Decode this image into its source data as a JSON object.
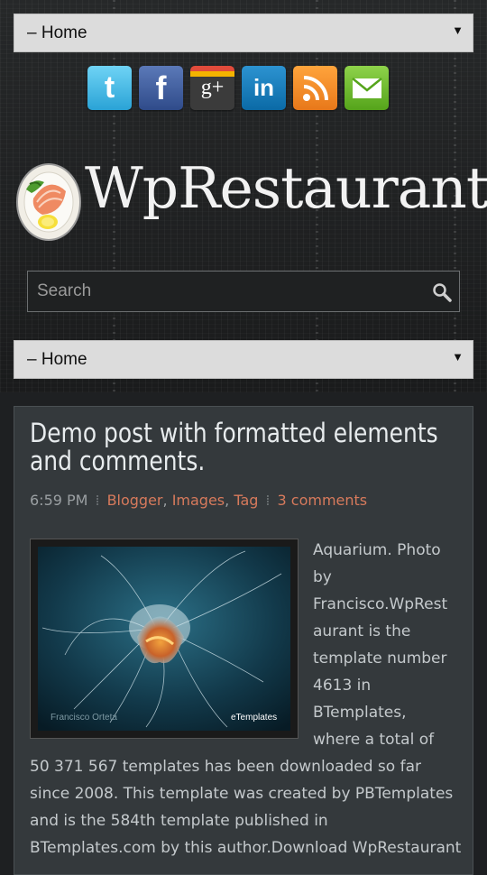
{
  "nav": {
    "top_select": "– Home",
    "bottom_select": "– Home"
  },
  "social": [
    {
      "icon": "twitter-icon",
      "glyph": "t",
      "color": "#3fbbe8"
    },
    {
      "icon": "facebook-icon",
      "glyph": "f",
      "color": "#3b5998"
    },
    {
      "icon": "google-plus-icon",
      "glyph": "g+",
      "color": "#333333"
    },
    {
      "icon": "linkedin-icon",
      "glyph": "in",
      "color": "#1179b8"
    },
    {
      "icon": "rss-icon",
      "glyph": "rss",
      "color": "#f58b1f"
    },
    {
      "icon": "email-icon",
      "glyph": "mail",
      "color": "#6dbb2f"
    }
  ],
  "site": {
    "title": "WpRestaurant"
  },
  "search": {
    "placeholder": "Search"
  },
  "post": {
    "title": "Demo post with formatted elements and comments.",
    "time": "6:59 PM",
    "labels": [
      "Blogger",
      "Images",
      "Tag"
    ],
    "comments": "3 comments",
    "image_watermark": "eTemplates",
    "image_credit": "Francisco Orteta",
    "side_lines": [
      "Aquarium. Photo",
      "by",
      "Francisco.WpRest",
      "aurant is the",
      "template number",
      "4613 in",
      "BTemplates,",
      "where a total of"
    ],
    "full_lines": [
      "50 371 567 templates has been downloaded so far",
      "since 2008. This template was created by PBTemplates",
      "and is the 584th template published in",
      "BTemplates.com by this author.Download WpRestaurant"
    ]
  }
}
